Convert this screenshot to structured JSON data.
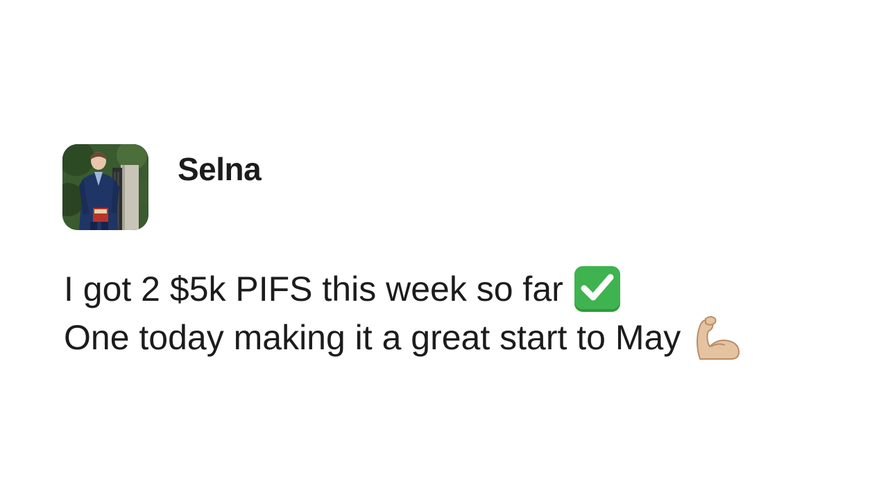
{
  "message": {
    "author": "Selna",
    "lines": [
      {
        "text": "I got 2 $5k PIFS this week so far",
        "emoji": "white-heavy-check-mark-icon"
      },
      {
        "text": "One today making it a great start to May",
        "emoji": "flexed-biceps-icon"
      }
    ]
  },
  "colors": {
    "text": "#1d1c1d",
    "background": "#ffffff",
    "check_green": "#3fb34f",
    "skin_tone": "#e6c3a0"
  }
}
